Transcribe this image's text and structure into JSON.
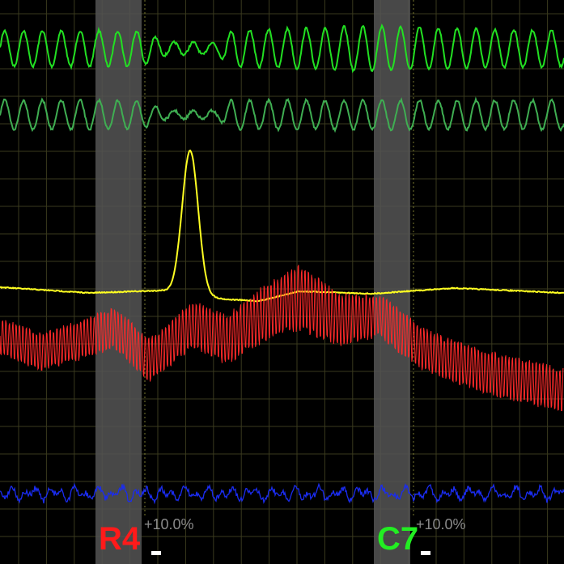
{
  "chart_data": {
    "type": "line",
    "grid": true,
    "x_range": [
      0,
      697
    ],
    "background": "#000000",
    "grid_color": "#3a3a1e",
    "marker_color": "#555555",
    "series": [
      {
        "color": "#22e022",
        "kind": "osc",
        "base": 60,
        "amp": 22,
        "period": 23.3,
        "modulation": [
          [
            0,
            1
          ],
          [
            175,
            1
          ],
          [
            205,
            0.35
          ],
          [
            270,
            0.35
          ],
          [
            285,
            1
          ],
          [
            450,
            1.25
          ],
          [
            697,
            1
          ]
        ]
      },
      {
        "color": "#3fae52",
        "kind": "osc",
        "base": 142,
        "amp": 18,
        "period": 23.3,
        "modulation": [
          [
            0,
            1
          ],
          [
            175,
            1
          ],
          [
            205,
            0.3
          ],
          [
            270,
            0.3
          ],
          [
            285,
            1
          ],
          [
            697,
            1
          ]
        ]
      },
      {
        "color": "#ffff22",
        "kind": "baseline_peak",
        "baseline": [
          [
            0,
            355
          ],
          [
            110,
            362
          ],
          [
            200,
            359
          ],
          [
            280,
            370
          ],
          [
            320,
            372
          ],
          [
            370,
            360
          ],
          [
            460,
            363
          ],
          [
            560,
            356
          ],
          [
            697,
            362
          ]
        ],
        "peak": {
          "center": 235,
          "width": 14,
          "height": 178
        }
      },
      {
        "color": "#ff2a2a",
        "kind": "dense_osc",
        "trend": [
          [
            0,
            415
          ],
          [
            50,
            435
          ],
          [
            100,
            420
          ],
          [
            140,
            405
          ],
          [
            185,
            445
          ],
          [
            240,
            400
          ],
          [
            280,
            420
          ],
          [
            330,
            385
          ],
          [
            370,
            368
          ],
          [
            420,
            395
          ],
          [
            470,
            390
          ],
          [
            520,
            430
          ],
          [
            570,
            450
          ],
          [
            620,
            465
          ],
          [
            697,
            482
          ]
        ],
        "amp": [
          [
            0,
            28
          ],
          [
            200,
            34
          ],
          [
            300,
            40
          ],
          [
            370,
            50
          ],
          [
            450,
            35
          ],
          [
            550,
            32
          ],
          [
            650,
            35
          ],
          [
            697,
            33
          ]
        ],
        "period": 4.2
      },
      {
        "color": "#1a2cf0",
        "kind": "noise",
        "base": 610,
        "amp": 9
      }
    ],
    "markers": [
      {
        "label": "R4",
        "label_color": "#ff1a1a",
        "percent": "+10.0%",
        "x_start": 118,
        "x_end": 175
      },
      {
        "label": "C7",
        "label_color": "#22ee22",
        "percent": "+10.0%",
        "x_start": 462,
        "x_end": 507
      }
    ]
  }
}
